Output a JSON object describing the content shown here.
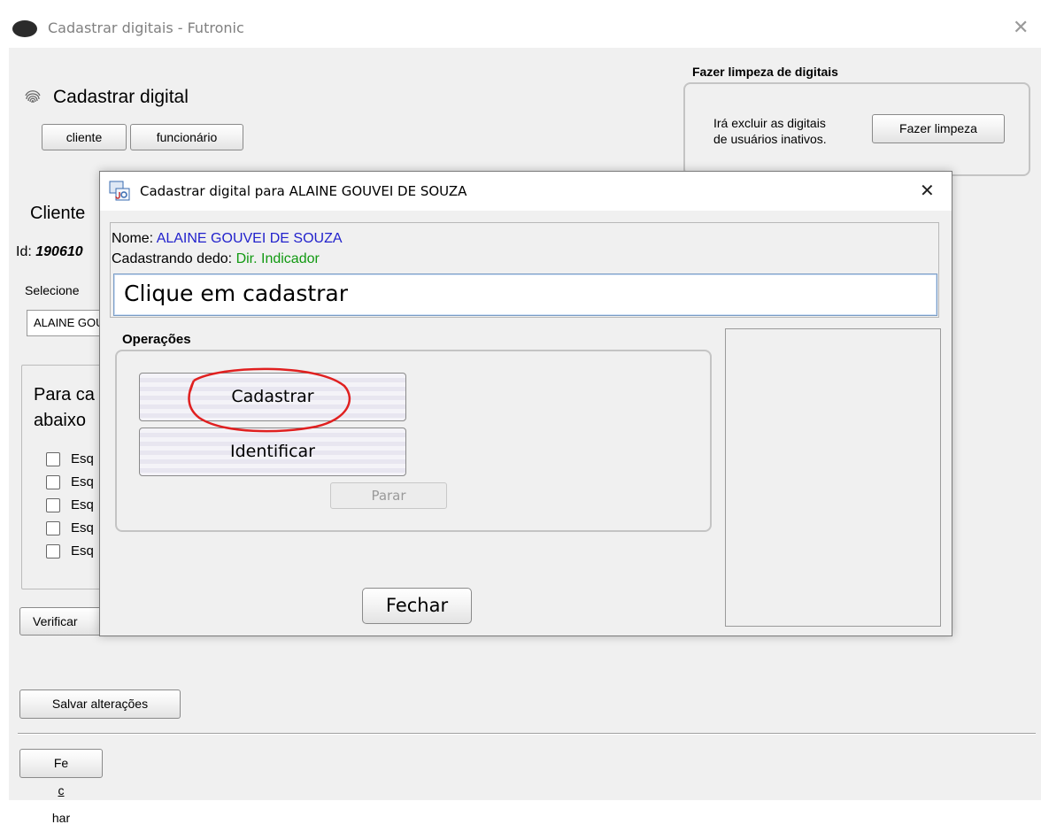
{
  "main_window": {
    "title": "Cadastrar digitais - Futronic",
    "close_glyph": "✕",
    "header_icon": "fingerprint-icon",
    "header_title": "Cadastrar digital",
    "btn_cliente": "cliente",
    "btn_funcionario": "funcionário",
    "cleanup": {
      "legend": "Fazer limpeza de digitais",
      "text_line1": "Irá excluir as digitais",
      "text_line2": "de usuários inativos.",
      "button": "Fazer limpeza"
    },
    "section_label": "Cliente",
    "id_label": "Id:",
    "id_value": "190610",
    "select_label": "Selecione",
    "select_value": "ALAINE GOUVEI DE SOUZA",
    "instruction_line1": "Para ca",
    "instruction_line2": "abaixo",
    "finger_checkbox_labels": [
      "Esq",
      "Esq",
      "Esq",
      "Esq",
      "Esq"
    ],
    "verify_button": "Verificar",
    "save_button": "Salvar alterações",
    "close_button_pre": "Fe",
    "close_button_mnemonic": "c",
    "close_button_post": "har"
  },
  "dialog": {
    "title": "Cadastrar digital para ALAINE GOUVEI DE SOUZA",
    "close_glyph": "✕",
    "name_label": "Nome:",
    "name_value": "ALAINE GOUVEI DE SOUZA",
    "finger_label": "Cadastrando dedo:",
    "finger_value": "Dir. Indicador",
    "status_message": "Clique em cadastrar",
    "operations_legend": "Operações",
    "btn_cadastrar": "Cadastrar",
    "btn_identificar": "Identificar",
    "btn_parar": "Parar",
    "btn_fechar": "Fechar"
  },
  "colors": {
    "name_value": "#2222cc",
    "finger_value": "#119911",
    "section_label": "#22a022",
    "annotation": "#e02020"
  }
}
